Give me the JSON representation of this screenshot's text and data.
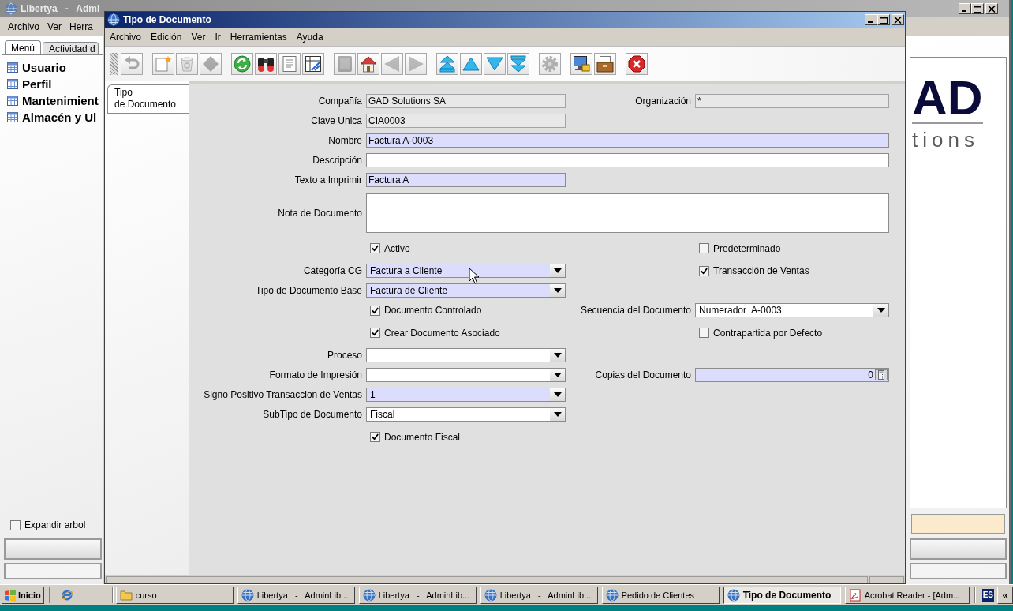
{
  "background_window": {
    "title": "Libertya   -   Admi",
    "menu": [
      "Archivo",
      "Ver",
      "Herra"
    ],
    "tabs": [
      {
        "label": "Menú",
        "selected": true
      },
      {
        "label": "Actividad d",
        "selected": false
      }
    ],
    "tree": [
      {
        "label": "Usuario"
      },
      {
        "label": "Perfil"
      },
      {
        "label": "Mantenimient"
      },
      {
        "label": "Almacén y Ul"
      }
    ],
    "expand_tree": {
      "label": "Expandir arbol",
      "checked": false
    },
    "logo": {
      "mark": "AD",
      "tagline": "tions"
    }
  },
  "window": {
    "title": "Tipo de Documento",
    "menu": [
      "Archivo",
      "Edición",
      "Ver",
      "Ir",
      "Herramientas",
      "Ayuda"
    ],
    "toolbar": [
      {
        "buttons": [
          {
            "kind": "undo",
            "disabled": true
          }
        ]
      },
      {
        "buttons": [
          {
            "kind": "new",
            "disabled": false
          },
          {
            "kind": "delete",
            "disabled": true
          },
          {
            "kind": "copy",
            "disabled": true
          }
        ]
      },
      {
        "buttons": [
          {
            "kind": "refresh",
            "disabled": false
          },
          {
            "kind": "find",
            "disabled": false
          },
          {
            "kind": "report",
            "disabled": false
          },
          {
            "kind": "grid",
            "disabled": false
          }
        ]
      },
      {
        "buttons": [
          {
            "kind": "attach",
            "disabled": true
          },
          {
            "kind": "home",
            "disabled": false
          },
          {
            "kind": "previous",
            "disabled": true
          },
          {
            "kind": "next",
            "disabled": true
          }
        ]
      },
      {
        "buttons": [
          {
            "kind": "first",
            "disabled": false
          },
          {
            "kind": "up",
            "disabled": false
          },
          {
            "kind": "down",
            "disabled": false
          },
          {
            "kind": "last",
            "disabled": false
          }
        ]
      },
      {
        "buttons": [
          {
            "kind": "process",
            "disabled": true
          }
        ]
      },
      {
        "buttons": [
          {
            "kind": "screen",
            "disabled": false
          },
          {
            "kind": "archive",
            "disabled": false
          }
        ]
      },
      {
        "buttons": [
          {
            "kind": "exit",
            "disabled": false
          }
        ]
      }
    ],
    "tabs": [
      {
        "label": "Tipo\nde Documento",
        "selected": true
      }
    ],
    "form": {
      "rows": [
        {
          "left": {
            "kind": "text",
            "label": "Compañía",
            "value": "GAD Solutions SA",
            "readonly": true,
            "mandatory": false,
            "wide": false
          },
          "right": {
            "kind": "text",
            "label": "Organización",
            "value": "*",
            "readonly": true,
            "mandatory": false
          }
        },
        {
          "left": {
            "kind": "text",
            "label": "Clave Unica",
            "value": "CIA0003",
            "readonly": true,
            "mandatory": false,
            "wide": false
          }
        },
        {
          "left": {
            "kind": "text",
            "label": "Nombre",
            "value": "Factura A-0003",
            "readonly": false,
            "mandatory": true,
            "wide": true
          }
        },
        {
          "left": {
            "kind": "text",
            "label": "Descripción",
            "readonly": false,
            "mandatory": false,
            "wide": true
          }
        },
        {
          "left": {
            "kind": "text",
            "label": "Texto a Imprimir",
            "value": "Factura A",
            "readonly": false,
            "mandatory": true,
            "wide": false
          }
        },
        {
          "left": {
            "kind": "textarea",
            "label": "Nota de Documento",
            "readonly": false,
            "mandatory": false,
            "wide": true
          }
        },
        {
          "left": {
            "kind": "checkbox",
            "label": "Activo",
            "checked": true
          },
          "right": {
            "kind": "checkbox",
            "label": "Predeterminado",
            "checked": false
          }
        },
        {
          "left": {
            "kind": "combo",
            "label": "Categoría CG",
            "value": "Factura a Cliente",
            "readonly": false,
            "mandatory": true,
            "wide": false
          },
          "right": {
            "kind": "checkbox",
            "label": "Transacción de Ventas",
            "checked": true
          }
        },
        {
          "left": {
            "kind": "combo",
            "label": "Tipo de Documento Base",
            "value": "Factura de Cliente",
            "readonly": false,
            "mandatory": true,
            "wide": false
          }
        },
        {
          "left": {
            "kind": "checkbox",
            "label": "Documento Controlado",
            "checked": true
          },
          "right": {
            "kind": "combo",
            "label": "Secuencia del Documento",
            "value": "Numerador  A-0003",
            "readonly": false,
            "mandatory": false
          }
        },
        {
          "left": {
            "kind": "checkbox",
            "label": "Crear Documento Asociado",
            "checked": true
          },
          "right": {
            "kind": "checkbox",
            "label": "Contrapartida por Defecto",
            "checked": false
          }
        },
        {
          "left": {
            "kind": "combo",
            "label": "Proceso",
            "readonly": false,
            "mandatory": false,
            "wide": false
          }
        },
        {
          "left": {
            "kind": "combo",
            "label": "Formato de Impresión",
            "readonly": false,
            "mandatory": false,
            "wide": false
          },
          "right": {
            "kind": "number",
            "label": "Copias del Documento",
            "value": "0",
            "readonly": false,
            "mandatory": true
          }
        },
        {
          "left": {
            "kind": "combo",
            "label": "Signo Positivo Transaccion de Ventas",
            "value": "1",
            "readonly": false,
            "mandatory": true,
            "wide": false
          }
        },
        {
          "left": {
            "kind": "combo",
            "label": "SubTipo de Documento",
            "value": "Fiscal",
            "readonly": false,
            "mandatory": false,
            "wide": false
          }
        },
        {
          "left": {
            "kind": "checkbox",
            "label": "Documento Fiscal",
            "checked": true
          }
        }
      ]
    }
  },
  "taskbar": {
    "start": "Inicio",
    "tasks": [
      {
        "label": "curso",
        "kind": "folder",
        "selected": false
      },
      {
        "label": "Libertya   -   AdminLib...",
        "kind": "app",
        "selected": false
      },
      {
        "label": "Libertya   -   AdminLib...",
        "kind": "app",
        "selected": false
      },
      {
        "label": "Libertya   -   AdminLib...",
        "kind": "app",
        "selected": false
      },
      {
        "label": "Pedido de Clientes",
        "kind": "app",
        "selected": false
      },
      {
        "label": "Tipo de Documento",
        "kind": "app",
        "selected": true
      },
      {
        "label": "Acrobat Reader - [Adm...",
        "kind": "pdf",
        "selected": false
      }
    ],
    "language": "ES",
    "tray_toggle": "«"
  }
}
